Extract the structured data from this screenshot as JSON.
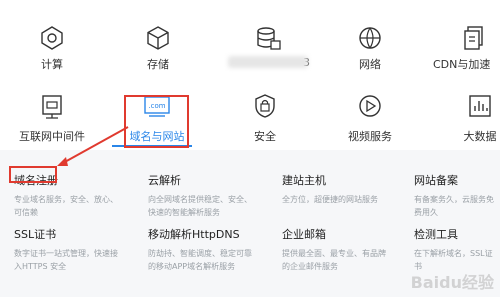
{
  "categories_row1": [
    {
      "label": "计算",
      "icon": "compute-icon"
    },
    {
      "label": "存储",
      "icon": "storage-icon"
    },
    {
      "label": "3",
      "icon": "database-icon"
    },
    {
      "label": "网络",
      "icon": "network-icon"
    },
    {
      "label": "CDN与加速",
      "icon": "cdn-icon"
    }
  ],
  "categories_row2": [
    {
      "label": "互联网中间件",
      "icon": "middleware-icon"
    },
    {
      "label": "域名与网站",
      "icon": "domain-website-icon",
      "active": true
    },
    {
      "label": "安全",
      "icon": "security-icon"
    },
    {
      "label": "视频服务",
      "icon": "video-icon"
    },
    {
      "label": "大数据",
      "icon": "bigdata-icon"
    }
  ],
  "icon_texts": {
    "com": ".com"
  },
  "products": [
    {
      "title": "域名注册",
      "desc": "专业域名服务，安全、放心、可信赖"
    },
    {
      "title": "云解析",
      "desc": "向全网域名提供稳定、安全、快速的智能解析服务"
    },
    {
      "title": "建站主机",
      "desc": "全方位，超便捷的网站服务"
    },
    {
      "title": "网站备案",
      "desc": "有备案务久，云服务免费用久"
    },
    {
      "title": "SSL证书",
      "desc": "数字证书一站式管理，快速接入HTTPS 安全"
    },
    {
      "title": "移动解析HttpDNS",
      "desc": "防劫持、智能调度、稳定可靠的移动APP域名解析服务"
    },
    {
      "title": "企业邮箱",
      "desc": "提供最全面、最专业、有品牌的企业邮件服务"
    },
    {
      "title": "检测工具",
      "desc": "在下解析域名，SSL证书"
    }
  ],
  "watermark": "Baidu经验",
  "colors": {
    "accent": "#2a86e8",
    "annotation": "#e03a2f"
  }
}
